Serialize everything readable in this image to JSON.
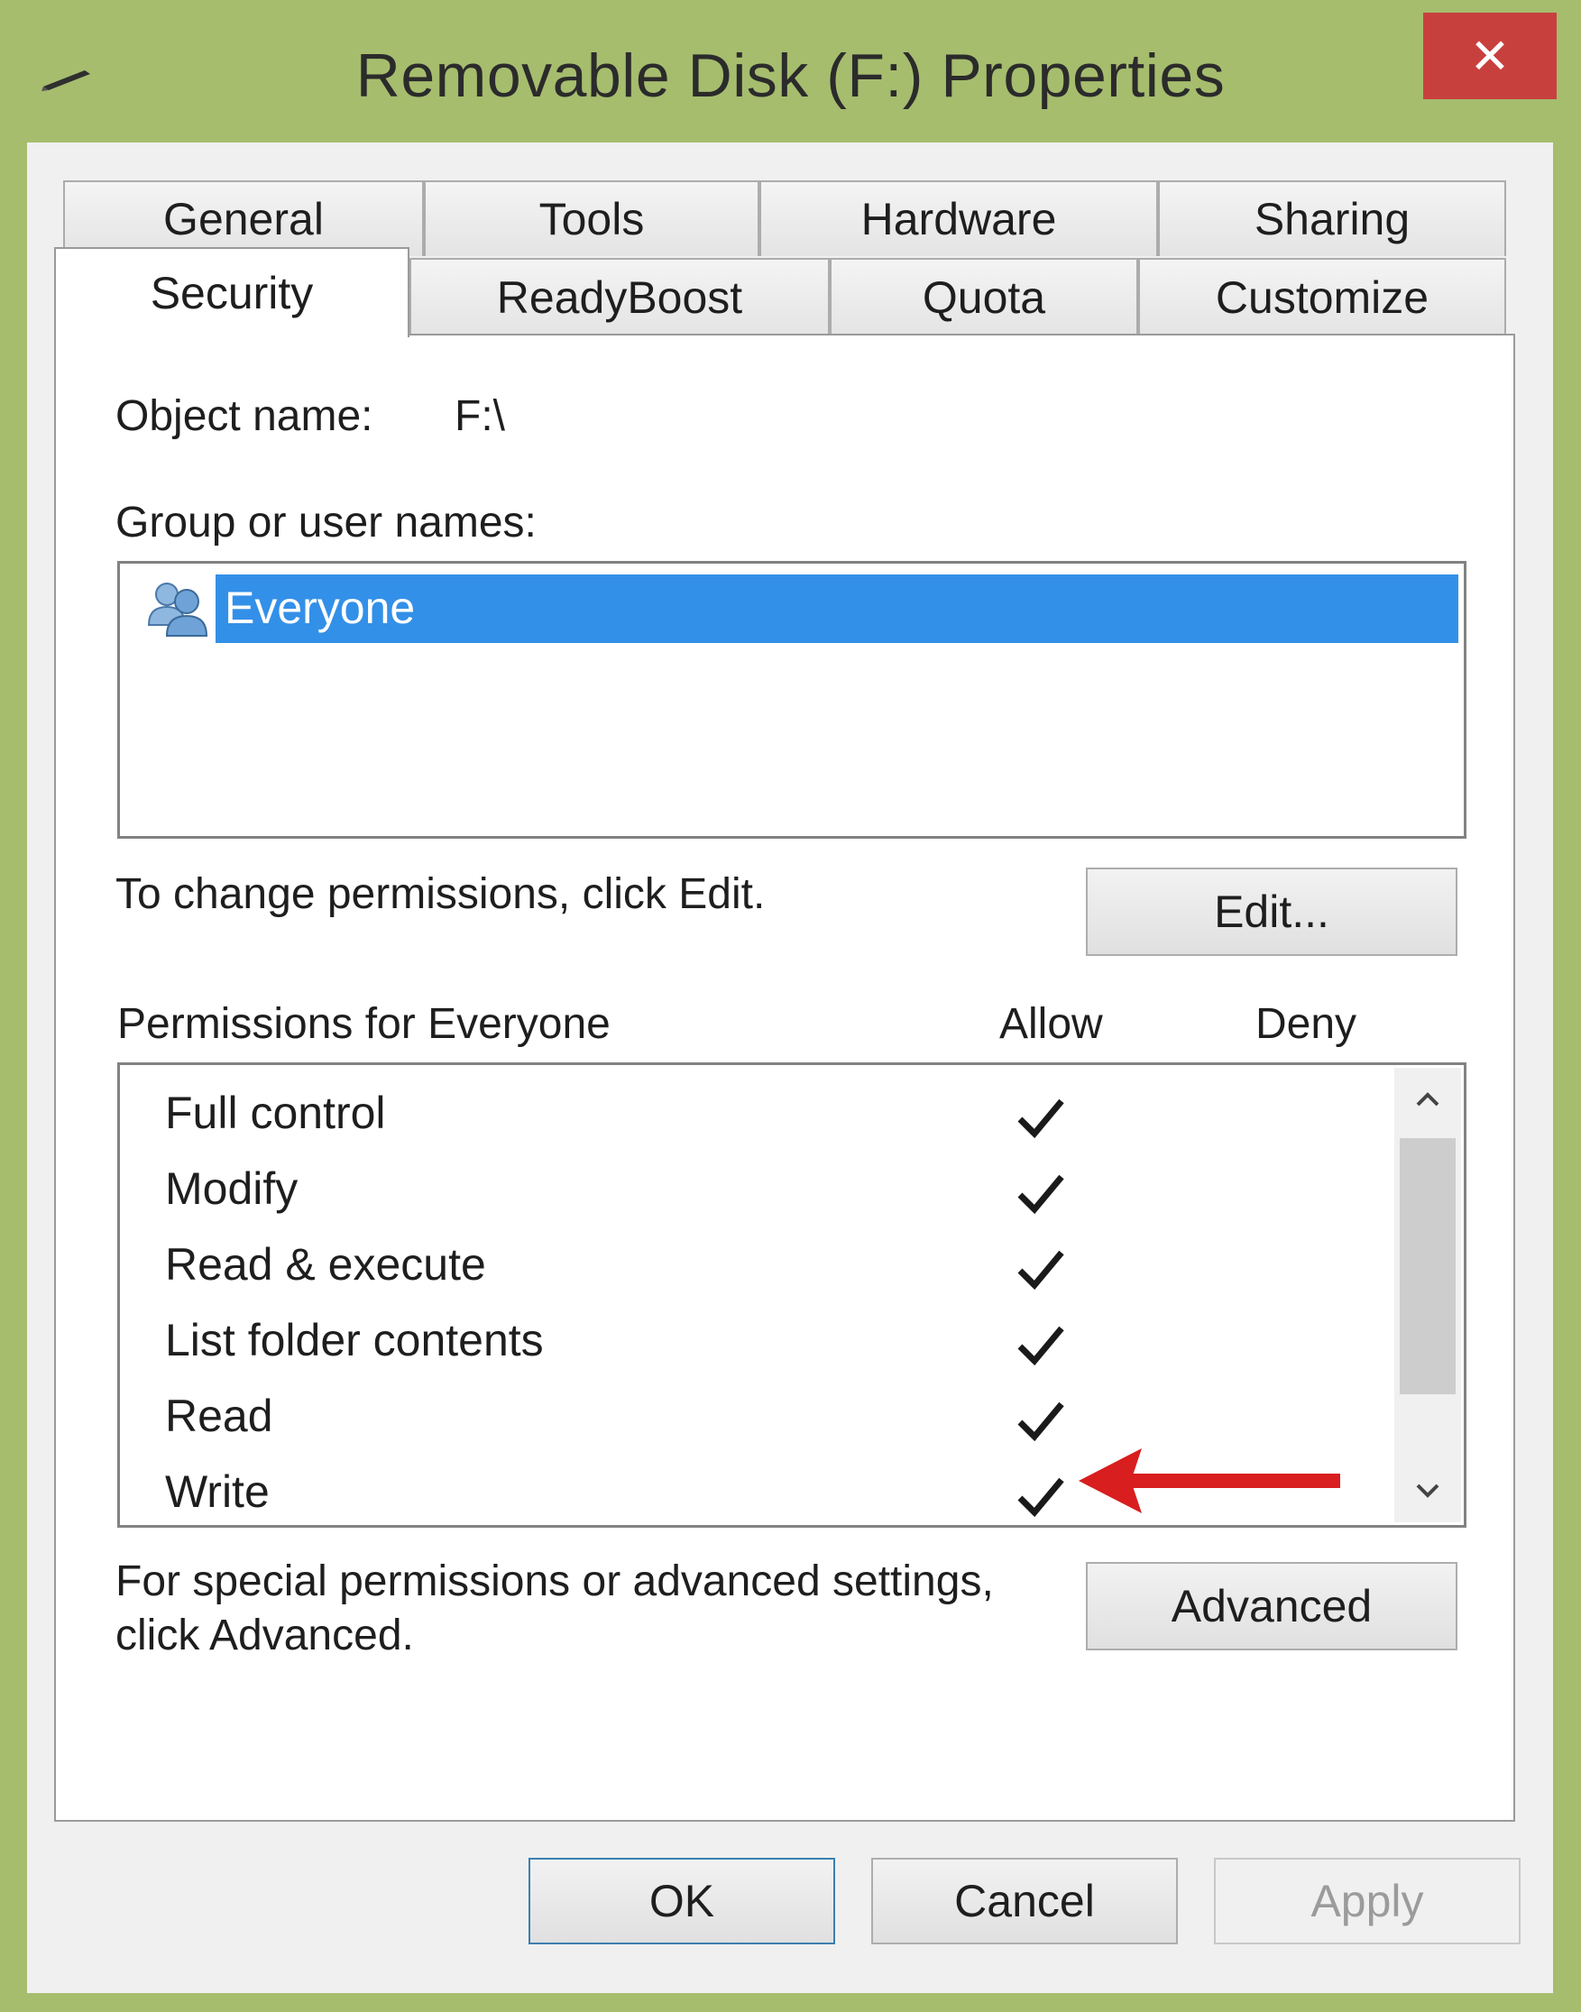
{
  "window": {
    "title": "Removable Disk (F:) Properties",
    "close_label": "✕",
    "accent_close": "#c8403e",
    "frame_color": "#a6bd6e"
  },
  "tabs": {
    "row1": [
      "General",
      "Tools",
      "Hardware",
      "Sharing"
    ],
    "row2": [
      "Security",
      "ReadyBoost",
      "Quota",
      "Customize"
    ],
    "active": "Security"
  },
  "security": {
    "object_name_label": "Object name:",
    "object_name_value": "F:\\",
    "group_label": "Group or user names:",
    "selected_user": "Everyone",
    "change_hint": "To change permissions, click Edit.",
    "edit_button": "Edit...",
    "permissions_header": "Permissions for Everyone",
    "allow_header": "Allow",
    "deny_header": "Deny",
    "permissions": [
      {
        "name": "Full control",
        "allow": true,
        "deny": false
      },
      {
        "name": "Modify",
        "allow": true,
        "deny": false
      },
      {
        "name": "Read & execute",
        "allow": true,
        "deny": false
      },
      {
        "name": "List folder contents",
        "allow": true,
        "deny": false
      },
      {
        "name": "Read",
        "allow": true,
        "deny": false
      },
      {
        "name": "Write",
        "allow": true,
        "deny": false
      }
    ],
    "advanced_hint_line1": "For special permissions or advanced settings,",
    "advanced_hint_line2": "click Advanced.",
    "advanced_button": "Advanced"
  },
  "footer": {
    "ok": "OK",
    "cancel": "Cancel",
    "apply": "Apply"
  },
  "annotation": {
    "arrow_color": "#d81e1e",
    "points_to": "Write"
  },
  "icons": {
    "title": "pen-icon",
    "user": "users-group-icon",
    "scroll_up": "chevron-up-icon",
    "scroll_down": "chevron-down-icon"
  }
}
